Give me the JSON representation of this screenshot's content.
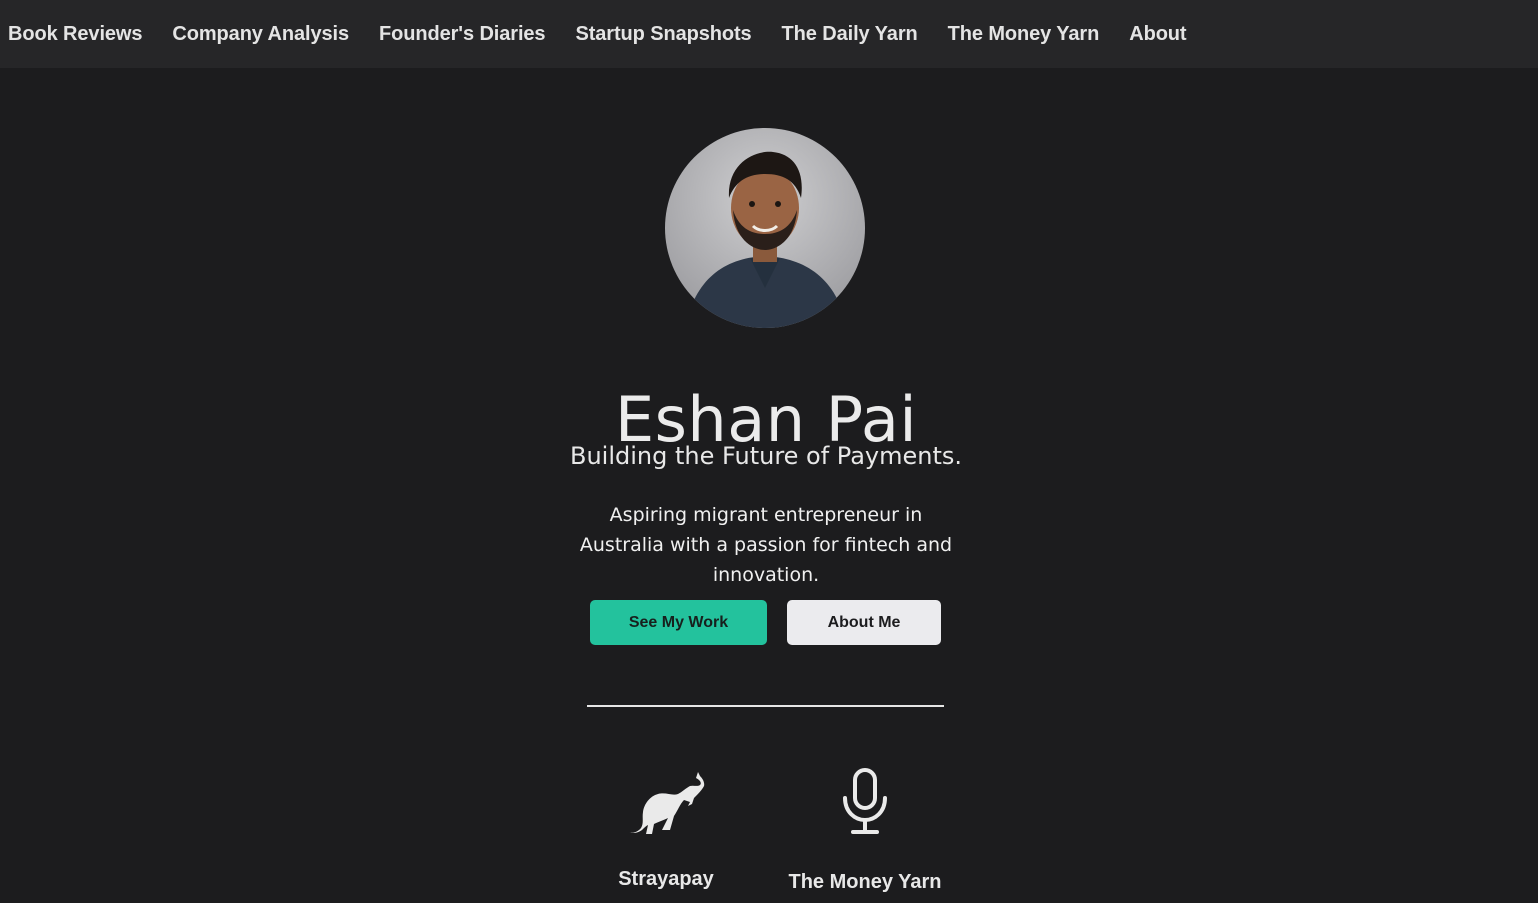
{
  "nav": {
    "items": [
      {
        "label": "Book Reviews"
      },
      {
        "label": "Company Analysis"
      },
      {
        "label": "Founder's Diaries"
      },
      {
        "label": "Startup Snapshots"
      },
      {
        "label": "The Daily Yarn"
      },
      {
        "label": "The Money Yarn"
      },
      {
        "label": "About"
      }
    ]
  },
  "hero": {
    "name": "Eshan Pai",
    "tagline": "Building the Future of Payments.",
    "bio": "Aspiring migrant entrepreneur in Australia with a passion for fintech and innovation.",
    "primary_button": "See My Work",
    "secondary_button": "About Me"
  },
  "projects": [
    {
      "title": "Strayapay",
      "icon": "kangaroo-icon"
    },
    {
      "title": "The Money Yarn",
      "icon": "microphone-icon"
    }
  ],
  "colors": {
    "background": "#1c1c1e",
    "nav_background": "#262628",
    "accent": "#23c29d",
    "secondary_button": "#ebebee"
  }
}
